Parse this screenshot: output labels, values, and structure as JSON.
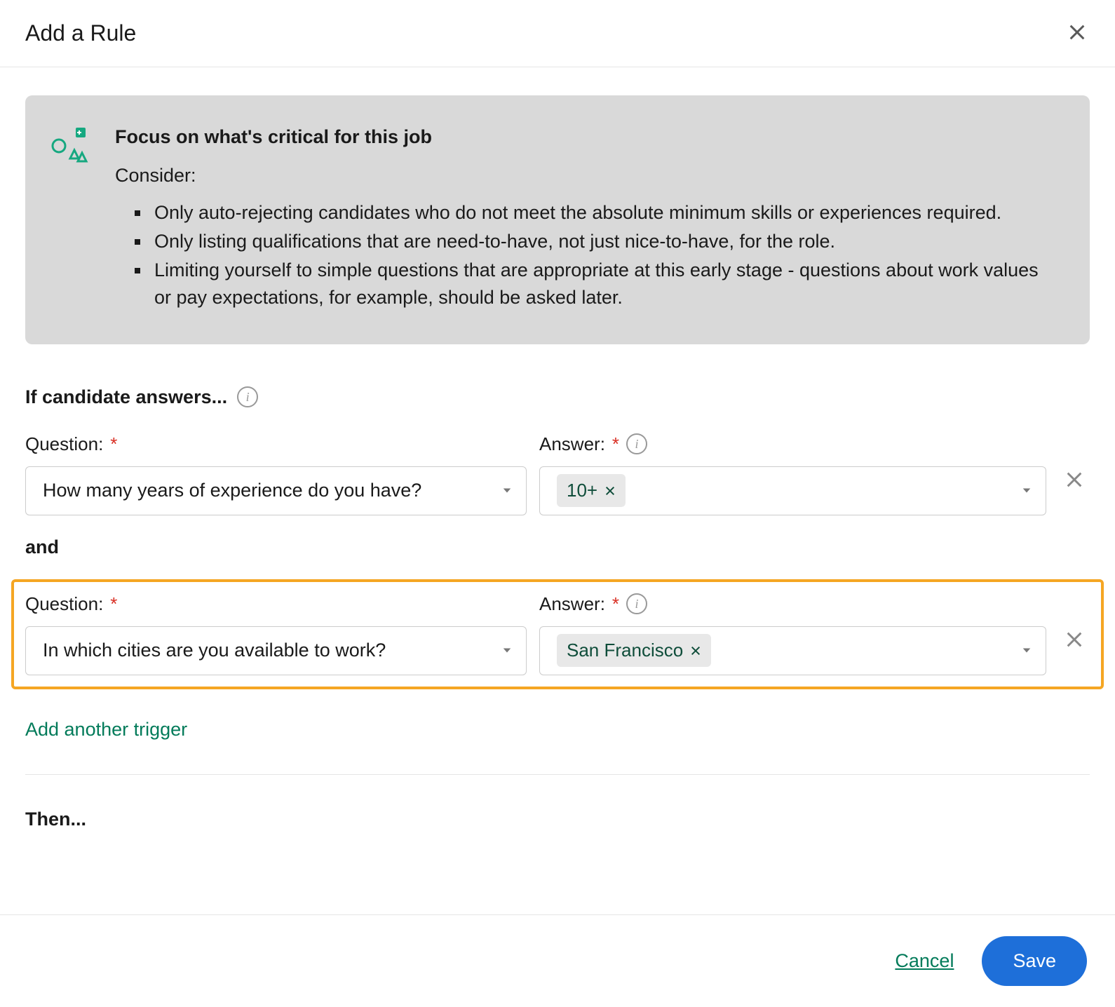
{
  "modal": {
    "title": "Add a Rule"
  },
  "tip": {
    "heading": "Focus on what's critical for this job",
    "consider_label": "Consider:",
    "bullets": [
      "Only auto-rejecting candidates who do not meet the absolute minimum skills or experiences required.",
      "Only listing qualifications that are need-to-have, not just nice-to-have, for the role.",
      "Limiting yourself to simple questions that are appropriate at this early stage - questions about work values or pay expectations, for example, should be asked later."
    ]
  },
  "condition_section": {
    "heading": "If candidate answers...",
    "question_label": "Question:",
    "answer_label": "Answer:",
    "and_label": "and",
    "add_trigger_label": "Add another trigger",
    "rows": [
      {
        "question": "How many years of experience do you have?",
        "answer_tag": "10+"
      },
      {
        "question": "In which cities are you available to work?",
        "answer_tag": "San Francisco"
      }
    ]
  },
  "then_section": {
    "heading": "Then..."
  },
  "footer": {
    "cancel_label": "Cancel",
    "save_label": "Save"
  }
}
